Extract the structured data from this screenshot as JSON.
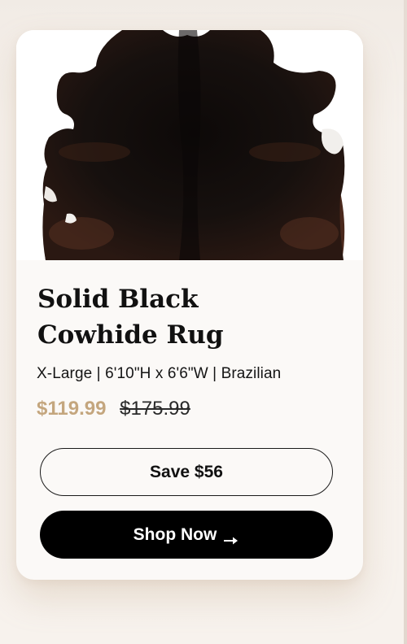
{
  "product": {
    "title_line1": "Solid Black",
    "title_line2": "Cowhide Rug",
    "specs": "X-Large | 6'10\"H x 6'6\"W | Brazilian",
    "price_sale": "$119.99",
    "price_original": "$175.99"
  },
  "actions": {
    "save_label": "Save $56",
    "shop_label": "Shop Now"
  },
  "icons": {
    "shop_arrow": "arrow-right-icon"
  },
  "colors": {
    "card_bg": "#fbf9f7",
    "page_bg": "#f4eee9",
    "sale_price": "#c4a67e",
    "primary_button": "#000000",
    "rug_body": "#130e0c",
    "rug_brown": "#4a281c"
  }
}
